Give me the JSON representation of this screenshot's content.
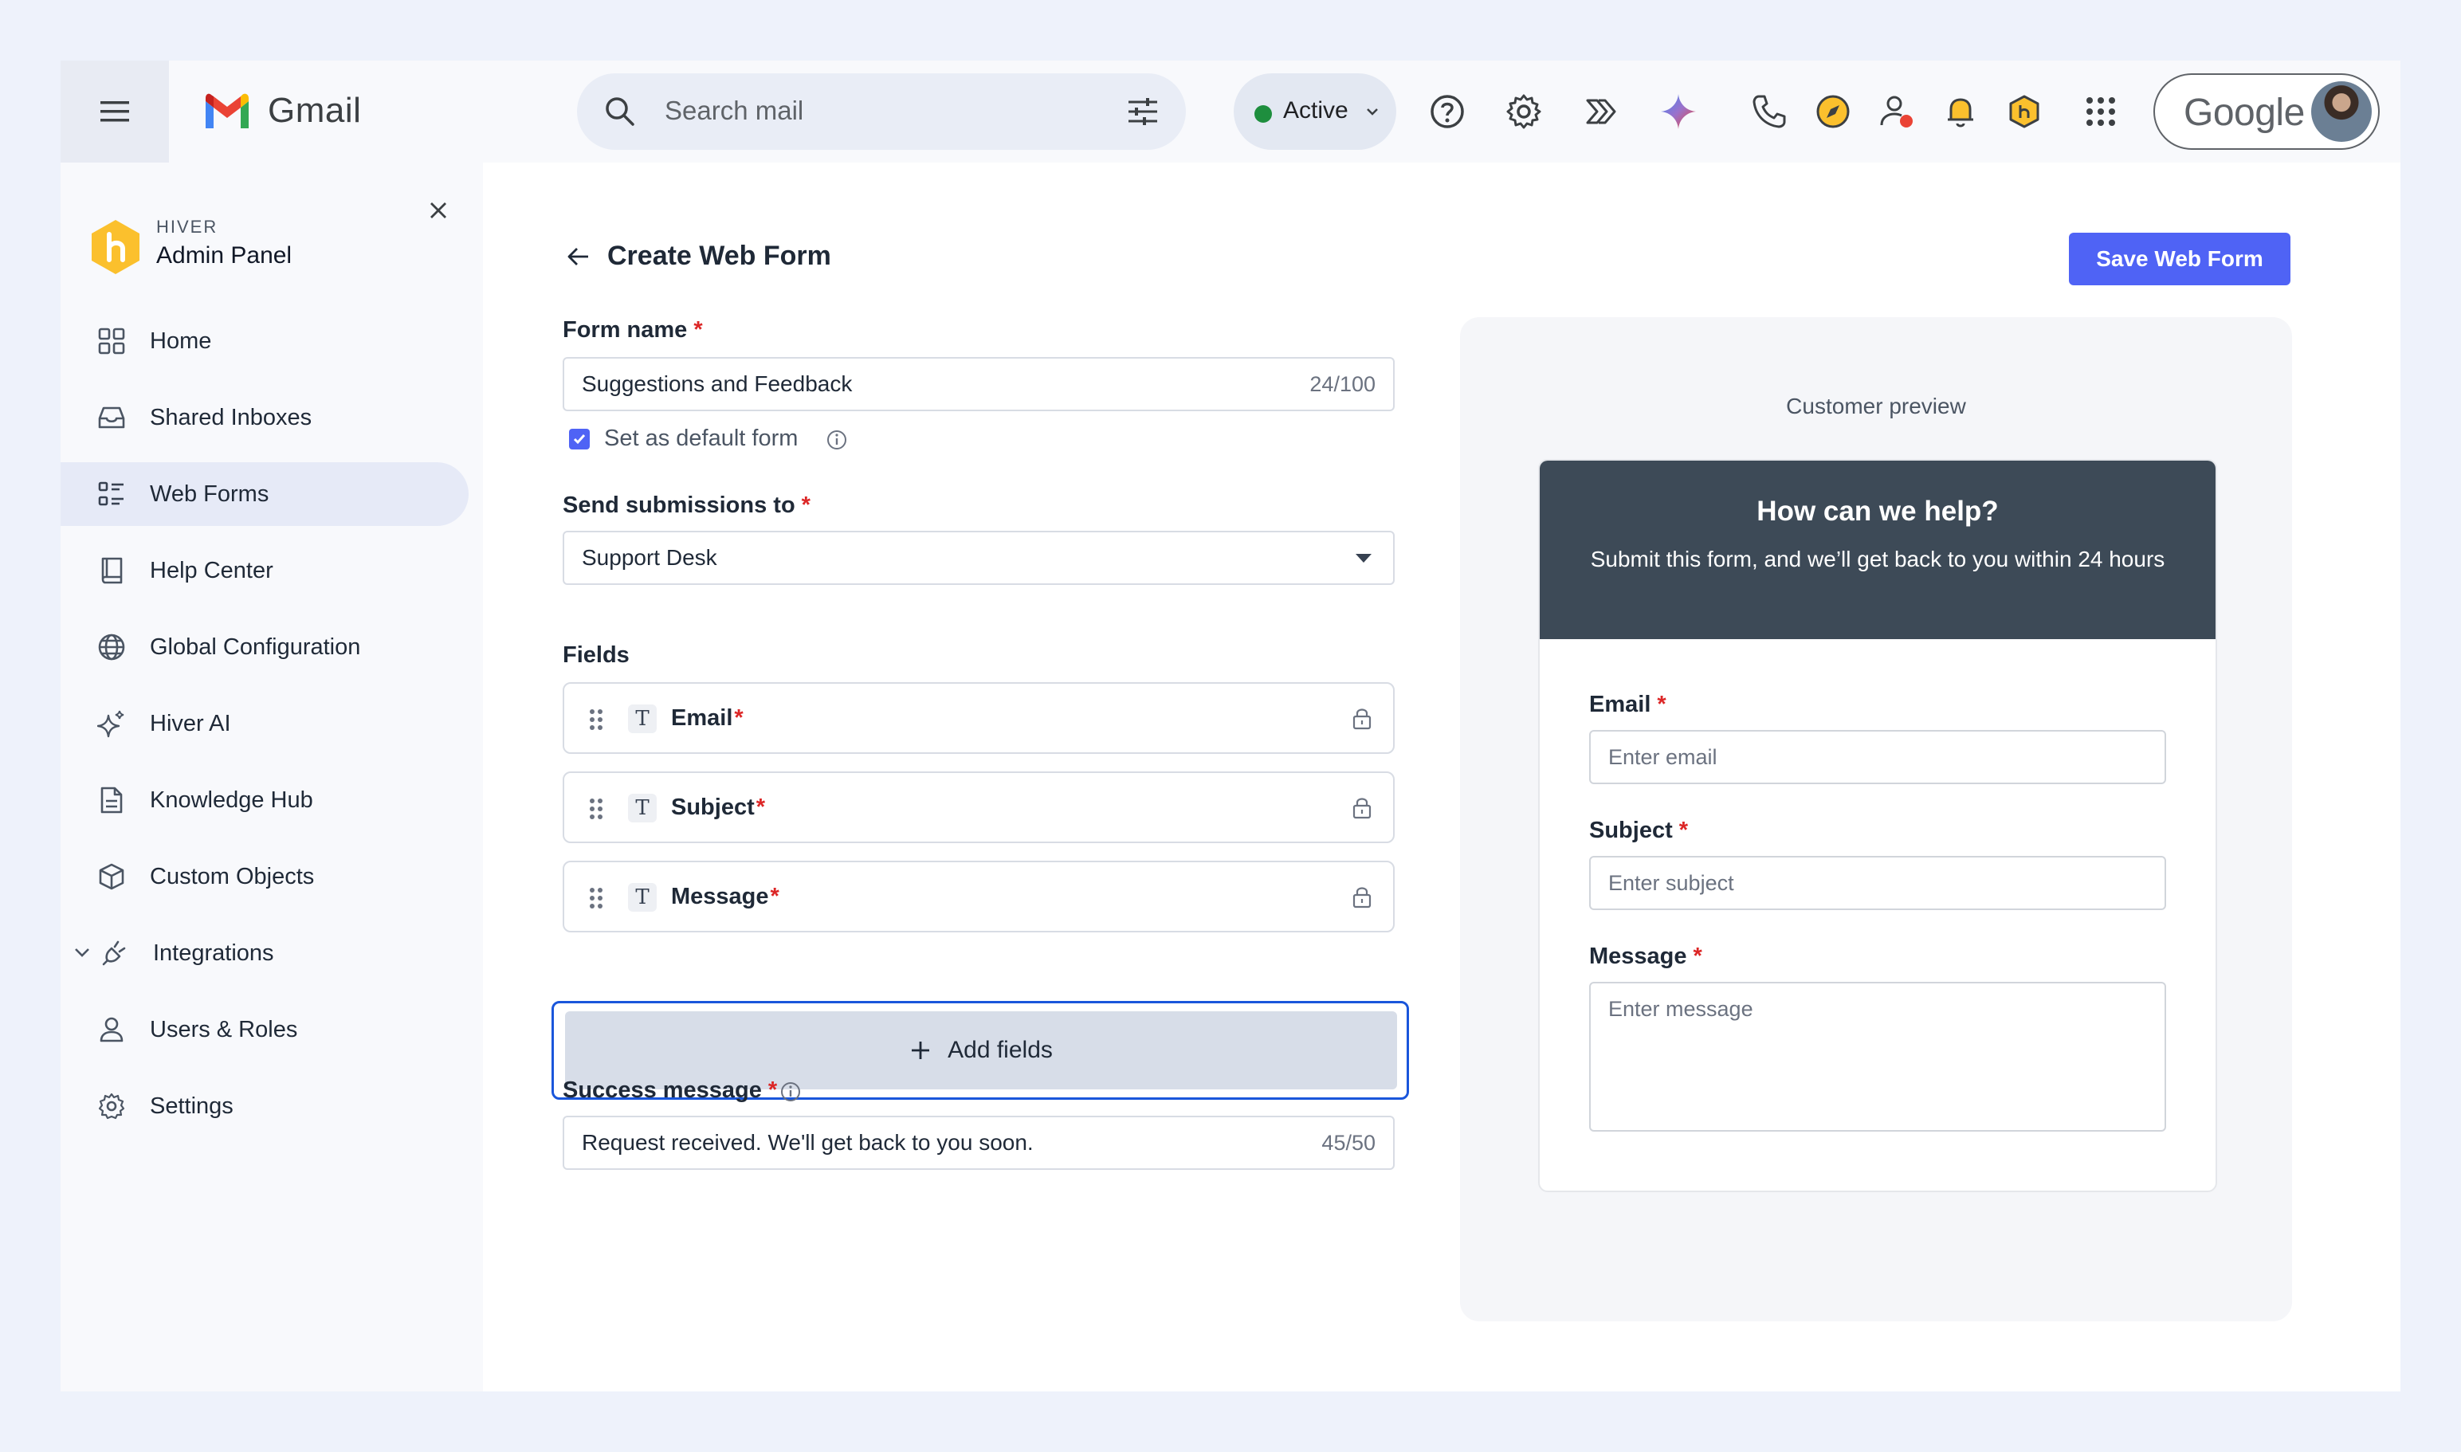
{
  "header": {
    "app_name": "Gmail",
    "search_placeholder": "Search mail",
    "status": "Active",
    "account_brand": "Google"
  },
  "sidebar": {
    "brand": "HIVER",
    "title": "Admin Panel",
    "items": [
      {
        "label": "Home",
        "icon": "grid-icon"
      },
      {
        "label": "Shared Inboxes",
        "icon": "inbox-icon"
      },
      {
        "label": "Web Forms",
        "icon": "form-list-icon",
        "active": true
      },
      {
        "label": "Help Center",
        "icon": "book-icon"
      },
      {
        "label": "Global Configuration",
        "icon": "globe-icon"
      },
      {
        "label": "Hiver AI",
        "icon": "sparkle-icon"
      },
      {
        "label": "Knowledge Hub",
        "icon": "document-icon"
      },
      {
        "label": "Custom Objects",
        "icon": "cube-icon"
      },
      {
        "label": "Integrations",
        "icon": "plug-icon",
        "expandable": true
      },
      {
        "label": "Users & Roles",
        "icon": "user-icon"
      },
      {
        "label": "Settings",
        "icon": "gear-icon"
      }
    ]
  },
  "form": {
    "page_title": "Create Web Form",
    "save_label": "Save Web Form",
    "form_name_label": "Form name",
    "form_name_value": "Suggestions and Feedback",
    "form_name_count": "24/100",
    "default_checkbox_label": "Set as default form",
    "default_checked": true,
    "send_to_label": "Send submissions to",
    "send_to_value": "Support Desk",
    "fields_label": "Fields",
    "fields": [
      {
        "name": "Email",
        "required": true
      },
      {
        "name": "Subject",
        "required": true
      },
      {
        "name": "Message",
        "required": true
      }
    ],
    "add_fields_label": "Add fields",
    "success_label": "Success message",
    "success_value": "Request received. We'll get back to you soon.",
    "success_count": "45/50",
    "required_mark": "*"
  },
  "preview": {
    "title": "Customer preview",
    "heading": "How can we help?",
    "subheading": "Submit this form, and we’ll get back to you within 24 hours",
    "email_label": "Email",
    "email_placeholder": "Enter email",
    "subject_label": "Subject",
    "subject_placeholder": "Enter subject",
    "message_label": "Message",
    "message_placeholder": "Enter message"
  },
  "colors": {
    "accent": "#4f63f5",
    "required": "#dc2626",
    "preview_header": "#3d4a57",
    "status_green": "#1e8e3e",
    "focus_border": "#1a56db"
  }
}
